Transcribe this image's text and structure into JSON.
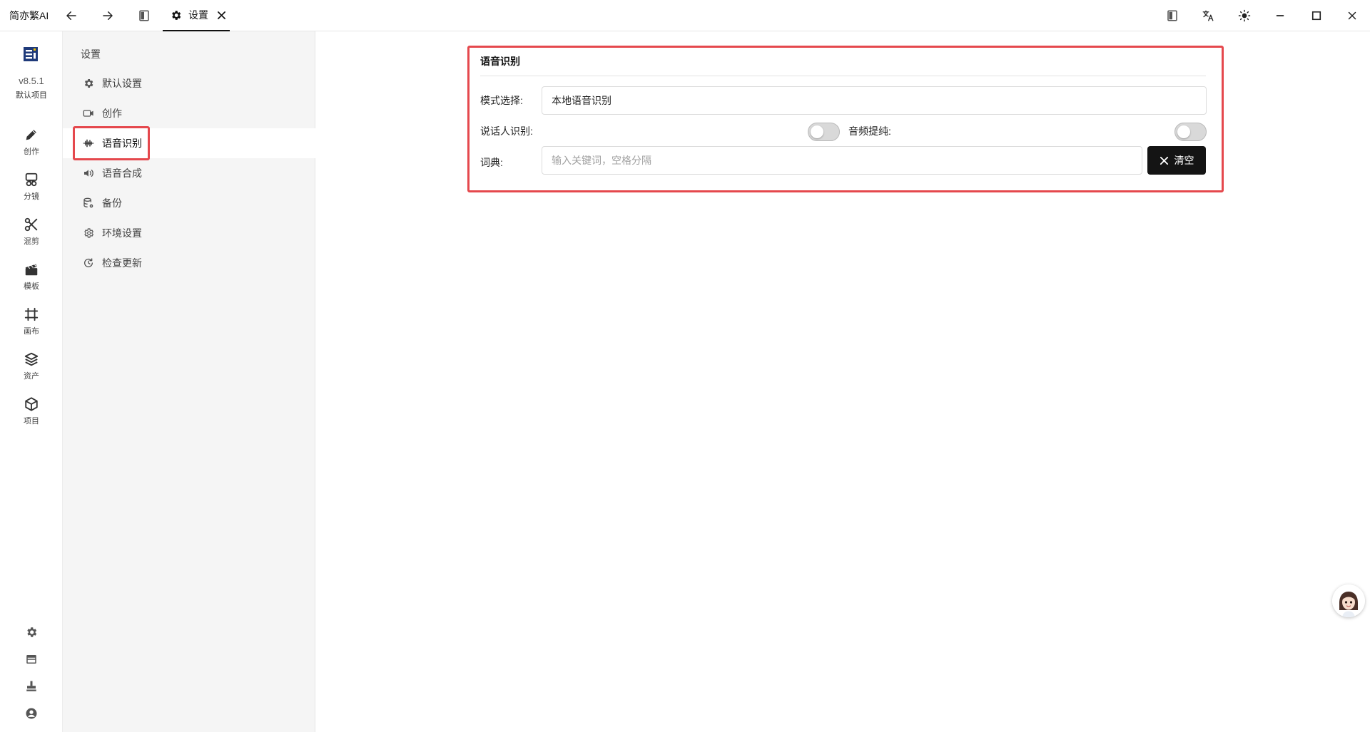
{
  "app": {
    "name": "简亦繁AI"
  },
  "tab": {
    "label": "设置"
  },
  "rail": {
    "version": "v8.5.1",
    "project": "默认项目",
    "items": [
      {
        "label": "创作",
        "icon": "pencil-icon"
      },
      {
        "label": "分镜",
        "icon": "storyboard-icon"
      },
      {
        "label": "混剪",
        "icon": "scissors-icon"
      },
      {
        "label": "模板",
        "icon": "clapperboard-icon"
      },
      {
        "label": "画布",
        "icon": "canvas-icon"
      },
      {
        "label": "资产",
        "icon": "layers-icon"
      },
      {
        "label": "项目",
        "icon": "box-icon"
      }
    ],
    "bottom_icons": [
      "gear-icon",
      "card-icon",
      "stamp-icon",
      "user-icon"
    ]
  },
  "menu": {
    "title": "设置",
    "items": [
      {
        "label": "默认设置",
        "icon": "gear-icon"
      },
      {
        "label": "创作",
        "icon": "video-camera-icon"
      },
      {
        "label": "语音识别",
        "icon": "waveform-icon",
        "active": true
      },
      {
        "label": "语音合成",
        "icon": "speaker-icon"
      },
      {
        "label": "备份",
        "icon": "database-gear-icon"
      },
      {
        "label": "环境设置",
        "icon": "gear-outline-icon"
      },
      {
        "label": "检查更新",
        "icon": "refresh-clock-icon"
      }
    ]
  },
  "panel": {
    "title": "语音识别",
    "mode_label": "模式选择:",
    "mode_value": "本地语音识别",
    "speaker_label": "说话人识别:",
    "speaker_enabled": false,
    "audio_label": "音频提纯:",
    "audio_enabled": false,
    "dict_label": "词典:",
    "dict_value": "",
    "dict_placeholder": "输入关键词，空格分隔",
    "clear_label": "清空"
  },
  "colors": {
    "highlight": "#e5484d",
    "primary_button": "#141414",
    "logo": "#1f3a7a"
  }
}
